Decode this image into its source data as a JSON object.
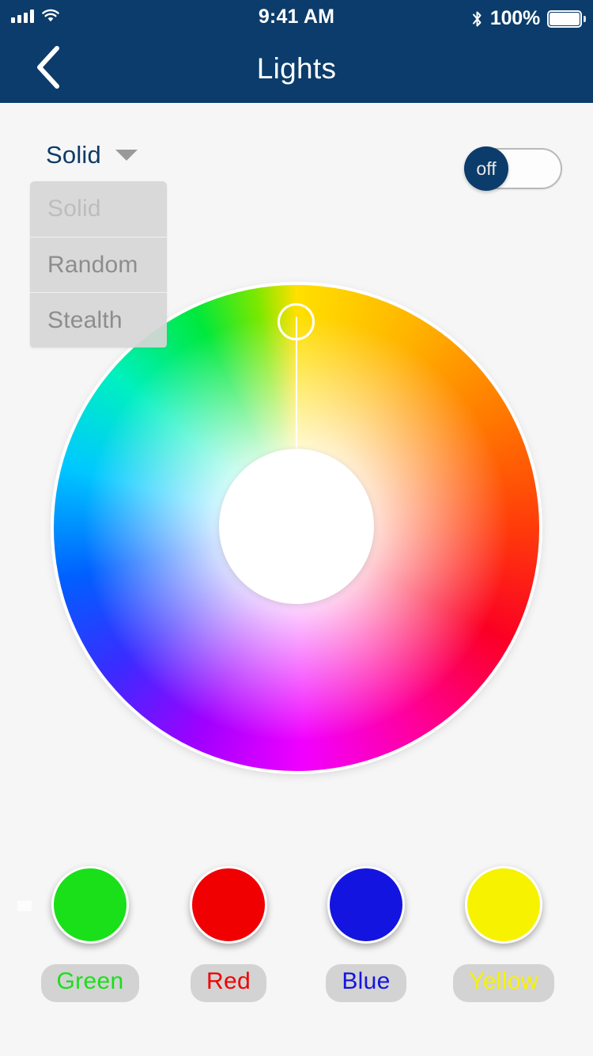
{
  "statusbar": {
    "time": "9:41 AM",
    "battery_percent": "100%",
    "signal_icon": "cellular-signal-icon",
    "wifi_icon": "wifi-icon",
    "bluetooth_icon": "bluetooth-icon",
    "battery_icon": "battery-full-icon"
  },
  "navbar": {
    "title": "Lights",
    "back_icon": "chevron-left-icon"
  },
  "mode": {
    "selected": "Solid",
    "caret_icon": "chevron-down-icon",
    "options": [
      "Solid",
      "Random",
      "Stealth"
    ]
  },
  "power": {
    "state_label": "off",
    "is_on": false
  },
  "wheel": {
    "selected_hue_degrees": 0,
    "handle_position": "top",
    "center_color": "#ffffff"
  },
  "presets": [
    {
      "label": "Green",
      "color": "#19e019",
      "text_color": "#19e019"
    },
    {
      "label": "Red",
      "color": "#f00000",
      "text_color": "#f00000"
    },
    {
      "label": "Blue",
      "color": "#1414e0",
      "text_color": "#1414e0"
    },
    {
      "label": "Yellow",
      "color": "#f7f200",
      "text_color": "#f7f200"
    }
  ],
  "theme": {
    "navy": "#0b3c6b",
    "page_bg": "#f6f6f7",
    "menu_bg": "#d6d6d6",
    "pill_bg": "#d3d3d3"
  }
}
